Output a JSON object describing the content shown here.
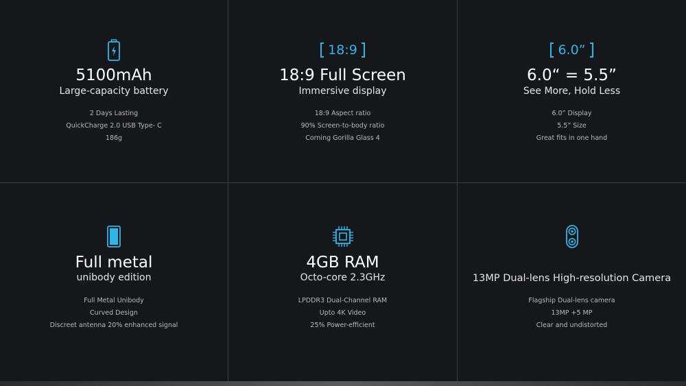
{
  "accent_color": "#2fb6ea",
  "features": [
    {
      "icon": "battery-icon",
      "headline": "5100mAh",
      "subtitle": "Large-capacity battery",
      "details": [
        "2 Days Lasting",
        "QuickCharge 2.0  USB Type- C",
        "186g"
      ]
    },
    {
      "icon": "aspect-ratio-badge",
      "badge": "18:9",
      "headline": "18:9 Full Screen",
      "subtitle": "Immersive display",
      "details": [
        "18:9 Aspect ratio",
        "90% Screen-to-body ratio",
        "Corning Gorilla Glass 4"
      ]
    },
    {
      "icon": "screen-size-badge",
      "badge": "6.0”",
      "headline": "6.0“ = 5.5”",
      "subtitle": "See More, Hold Less",
      "details": [
        "6.0” Display",
        "5.5” Size",
        "Great fits in one hand"
      ]
    },
    {
      "icon": "phone-body-icon",
      "headline": "Full metal",
      "subtitle": "unibody edition",
      "details": [
        "Full Metal Unibody",
        "Curved Design",
        "Discreet antenna 20% enhanced signal"
      ]
    },
    {
      "icon": "cpu-chip-icon",
      "headline": "4GB RAM",
      "subtitle": "Octo-core 2.3GHz",
      "details": [
        "LPDDR3 Dual-Channel RAM",
        "Upto 4K Video",
        "25% Power-efficient"
      ]
    },
    {
      "icon": "dual-camera-icon",
      "headline": "",
      "subtitle": "13MP Dual-lens High-resolution Camera",
      "details": [
        "Flagship Dual-lens camera",
        "13MP +5 MP",
        "Clear and undistorted"
      ]
    }
  ]
}
